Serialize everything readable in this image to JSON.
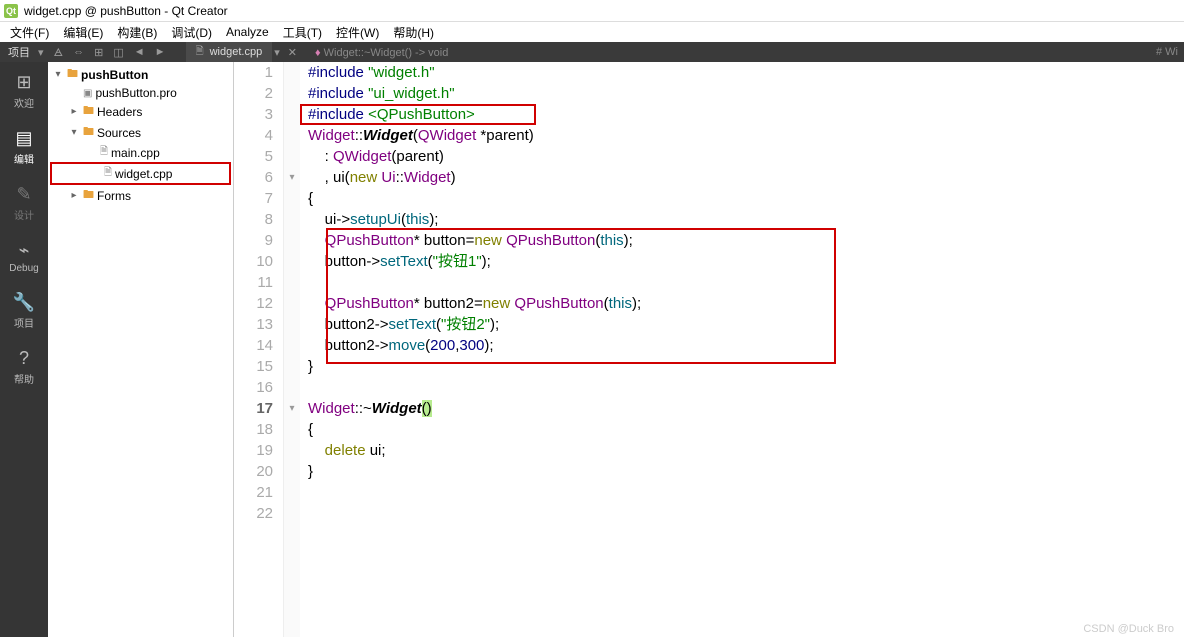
{
  "window": {
    "title": "widget.cpp @ pushButton - Qt Creator"
  },
  "menu": {
    "file": "文件(F)",
    "edit": "编辑(E)",
    "build": "构建(B)",
    "debug": "调试(D)",
    "analyze": "Analyze",
    "tools": "工具(T)",
    "control": "控件(W)",
    "help": "帮助(H)"
  },
  "toolbar": {
    "project_label": "项目",
    "tab_file": "widget.cpp",
    "crumb_class": "Widget::",
    "crumb_fn": "~Widget",
    "crumb_ret": "() -> void",
    "far_right": "# Wi"
  },
  "sidebar": {
    "items": [
      {
        "icon": "⊞",
        "label": "欢迎"
      },
      {
        "icon": "▤",
        "label": "编辑"
      },
      {
        "icon": "✎",
        "label": "设计"
      },
      {
        "icon": "⌁",
        "label": "Debug"
      },
      {
        "icon": "🔧",
        "label": "项目"
      },
      {
        "icon": "?",
        "label": "帮助"
      }
    ]
  },
  "tree": {
    "root": "pushButton",
    "pro": "pushButton.pro",
    "headers": "Headers",
    "sources": "Sources",
    "main": "main.cpp",
    "widget": "widget.cpp",
    "forms": "Forms"
  },
  "code": {
    "lines": [
      "#include \"widget.h\"",
      "#include \"ui_widget.h\"",
      "#include <QPushButton>",
      "Widget::Widget(QWidget *parent)",
      "    : QWidget(parent)",
      "    , ui(new Ui::Widget)",
      "{",
      "    ui->setupUi(this);",
      "    QPushButton* button=new QPushButton(this);",
      "    button->setText(\"按钮1\");",
      "",
      "    QPushButton* button2=new QPushButton(this);",
      "    button2->setText(\"按钮2\");",
      "    button2->move(200,300);",
      "}",
      "",
      "Widget::~Widget()",
      "{",
      "    delete ui;",
      "}",
      "",
      ""
    ]
  },
  "watermark": "CSDN @Duck Bro"
}
